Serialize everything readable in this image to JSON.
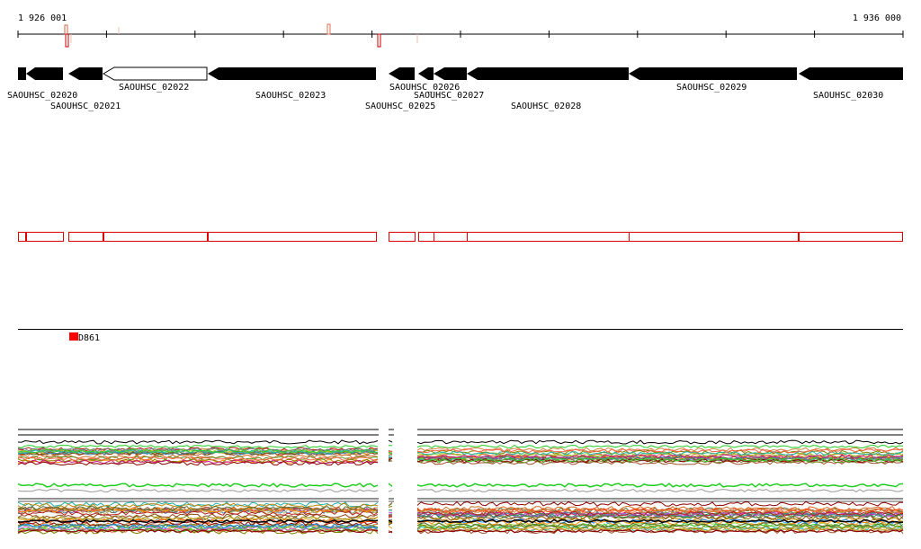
{
  "coords": {
    "start_label": "1 926 001",
    "end_label": "1 936 000"
  },
  "genes": [
    {
      "label": "SAOUHSC_02020",
      "filled": true
    },
    {
      "label": "SAOUHSC_02021",
      "filled": true
    },
    {
      "label": "SAOUHSC_02022",
      "filled": false
    },
    {
      "label": "SAOUHSC_02023",
      "filled": true
    },
    {
      "label": "SAOUHSC_02025",
      "filled": true
    },
    {
      "label": "SAOUHSC_02026",
      "filled": true
    },
    {
      "label": "SAOUHSC_02027",
      "filled": true
    },
    {
      "label": "SAOUHSC_02028",
      "filled": true
    },
    {
      "label": "SAOUHSC_02029",
      "filled": true
    },
    {
      "label": "SAOUHSC_02030",
      "filled": true
    }
  ],
  "feature_marker": {
    "label": "D861",
    "color": "#ff0000"
  },
  "colors": {
    "axis": "#000000",
    "gene_outline": "#000000",
    "region_box": "#ff0000",
    "tick_mark_red": "#cc0000",
    "tick_mark_pale": "#e8a090"
  }
}
